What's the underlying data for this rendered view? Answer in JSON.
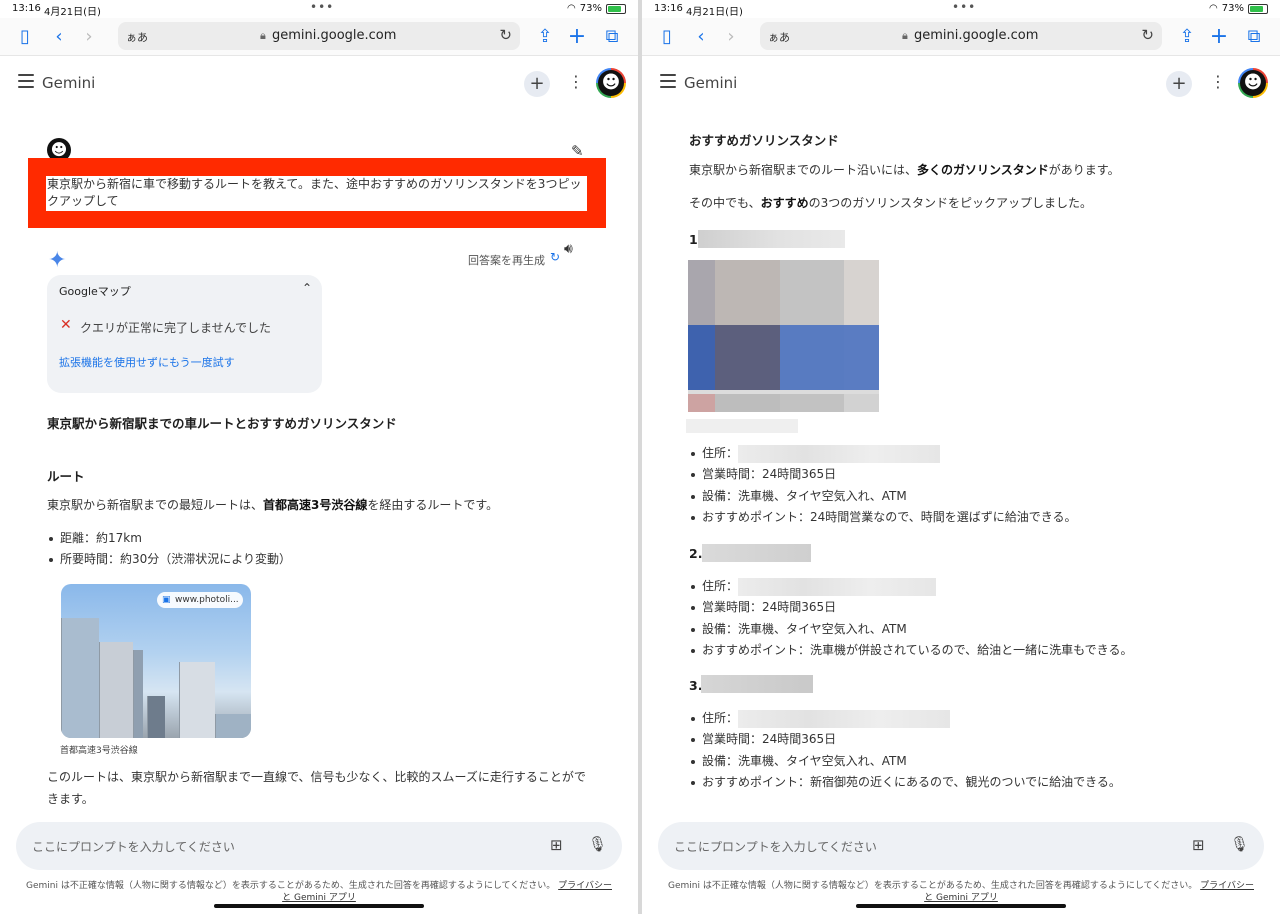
{
  "status": {
    "time": "13:16",
    "date": "4月21日(日)",
    "battery": "73%"
  },
  "browser": {
    "aa": "ぁあ",
    "url": "gemini.google.com"
  },
  "gemini": {
    "title": "Gemini",
    "new_chat": "+"
  },
  "left": {
    "prompt": "東京駅から新宿に車で移動するルートを教えて。また、途中おすすめのガソリンスタンドを3つピックアップして",
    "regenerate": "回答案を再生成",
    "extension": {
      "title": "Googleマップ",
      "error": "クエリが正常に完了しませんでした",
      "retry": "拡張機能を使用せずにもう一度試す"
    },
    "heading": "東京駅から新宿駅までの車ルートとおすすめガソリンスタンド",
    "route_heading": "ルート",
    "route_para_pre": "東京駅から新宿駅までの最短ルートは、",
    "route_para_bold": "首都高速3号渋谷線",
    "route_para_post": "を経由するルートです。",
    "bullets": [
      "距離：約17km",
      "所要時間：約30分（渋滞状況により変動）"
    ],
    "photo_source": "www.photoli...",
    "photo_caption": "首都高速3号渋谷線",
    "closing": "このルートは、東京駅から新宿駅まで一直線で、信号も少なく、比較的スムーズに走行することができます。"
  },
  "right": {
    "heading": "おすすめガソリンスタンド",
    "p1_pre": "東京駅から新宿駅までのルート沿いには、",
    "p1_bold": "多くのガソリンスタンド",
    "p1_post": "があります。",
    "p2_pre": "その中でも、",
    "p2_bold": "おすすめ",
    "p2_post": "の3つのガソリンスタンドをピックアップしました。",
    "stations": [
      {
        "num": "1.",
        "address_label": "住所：",
        "hours": "営業時間：24時間365日",
        "facilities": "設備：洗車機、タイヤ空気入れ、ATM",
        "point": "おすすめポイント：24時間営業なので、時間を選ばずに給油できる。"
      },
      {
        "num": "2.",
        "address_label": "住所：",
        "hours": "営業時間：24時間365日",
        "facilities": "設備：洗車機、タイヤ空気入れ、ATM",
        "point": "おすすめポイント：洗車機が併設されているので、給油と一緒に洗車もできる。"
      },
      {
        "num": "3.",
        "address_label": "住所：",
        "hours": "営業時間：24時間365日",
        "facilities": "設備：洗車機、タイヤ空気入れ、ATM",
        "point": "おすすめポイント：新宿御苑の近くにあるので、観光のついでに給油できる。"
      }
    ]
  },
  "input": {
    "placeholder": "ここにプロンプトを入力してください"
  },
  "disclaimer": {
    "text": "Gemini は不正確な情報（人物に関する情報など）を表示することがあるため、生成された回答を再確認するようにしてください。",
    "link1": "プライバシー",
    "link2": "と Gemini アプリ"
  },
  "colors": {
    "accent": "#1a73e8",
    "highlight": "#ff2a00",
    "error": "#d93025"
  }
}
